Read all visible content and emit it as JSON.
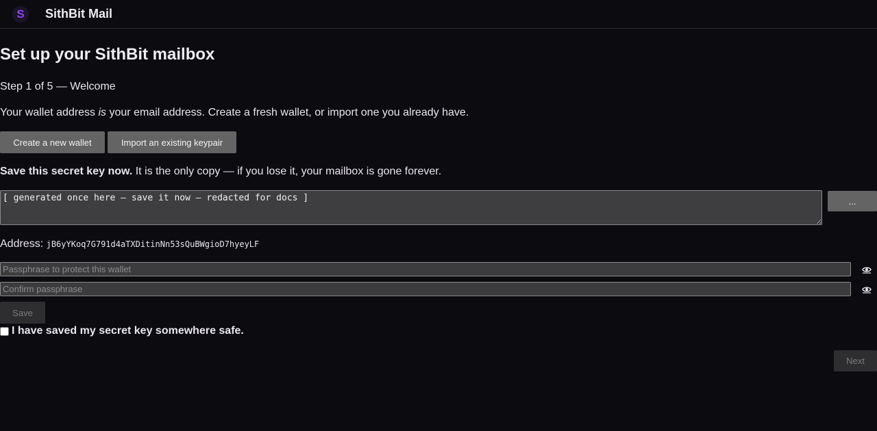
{
  "header": {
    "logo_letter": "S",
    "app_title": "SithBit Mail"
  },
  "page": {
    "title": "Set up your SithBit mailbox",
    "step": "Step 1 of 5 — Welcome",
    "intro_before": "Your wallet address ",
    "intro_emph": "is",
    "intro_after": " your email address. Create a fresh wallet, or import one you already have."
  },
  "actions": {
    "create_label": "Create a new wallet",
    "import_label": "Import an existing keypair"
  },
  "secret": {
    "warning_bold": "Save this secret key now.",
    "warning_rest": " It is the only copy — if you lose it, your mailbox is gone forever.",
    "value": "[ generated once here — save it now — redacted for docs ]",
    "more_label": "..."
  },
  "address": {
    "label": "Address:",
    "value": "jB6yYKoq7G791d4aTXDitinNn53sQuBWgioD7hyeyLF"
  },
  "passphrase": {
    "placeholder": "Passphrase to protect this wallet",
    "confirm_placeholder": "Confirm passphrase",
    "toggle_icon": "eye-icon",
    "save_label": "Save"
  },
  "acknowledge": {
    "label": "I have saved my secret key somewhere safe.",
    "checked": false
  },
  "footer": {
    "next_label": "Next"
  },
  "colors": {
    "background": "#0c0b10",
    "brand": "#8b46f0",
    "button": "#646464",
    "disabled_button": "#2e2e30"
  }
}
